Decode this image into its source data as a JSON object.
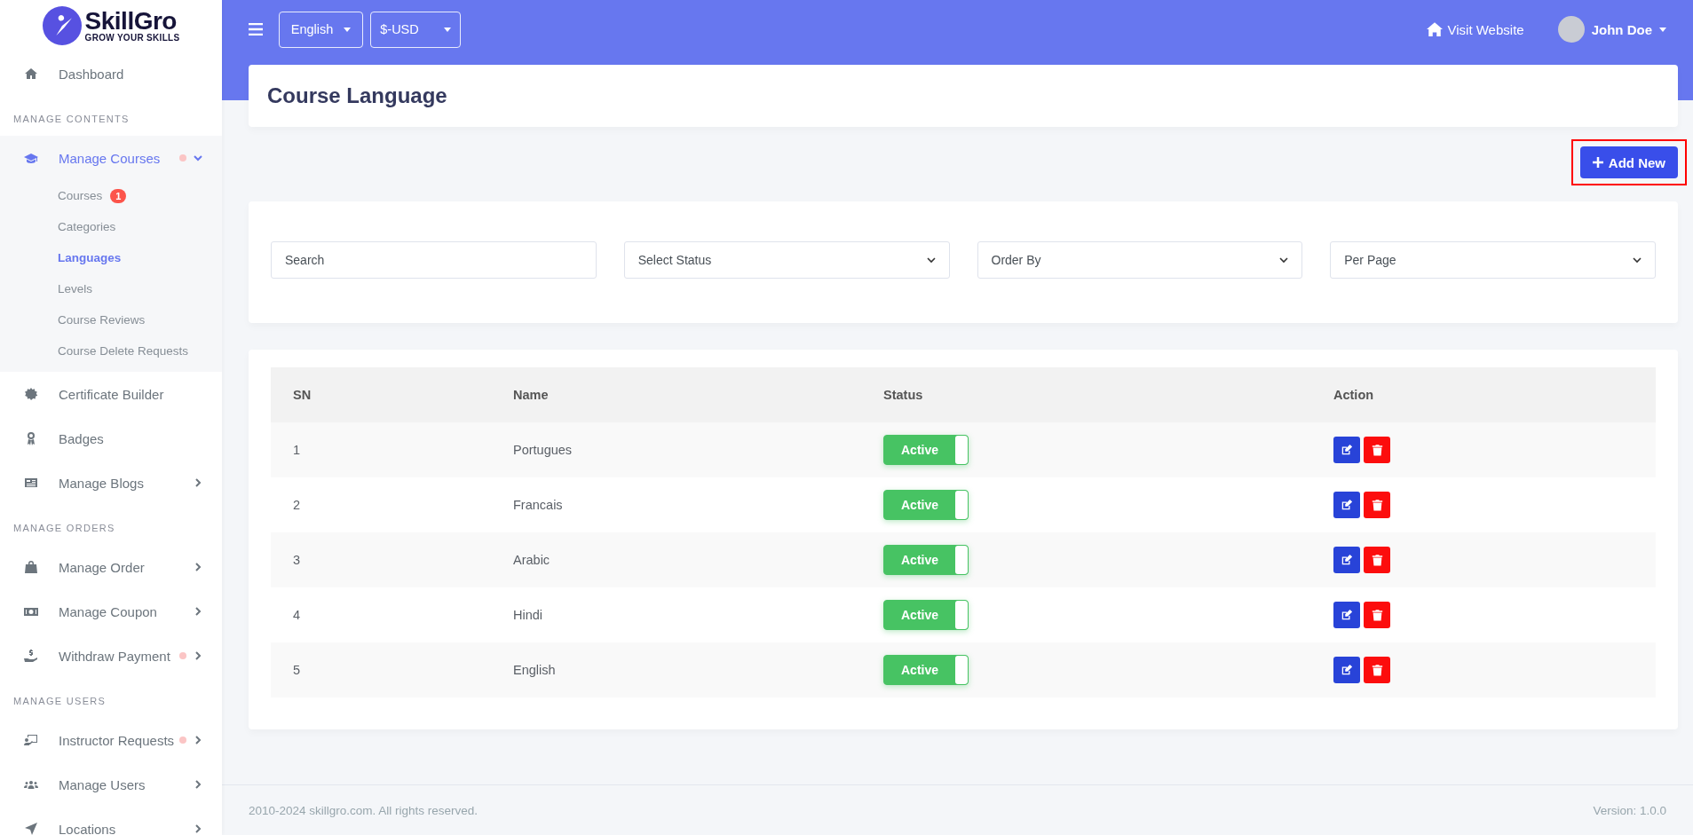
{
  "logo": {
    "name": "SkillGro",
    "tagline": "GROW YOUR SKILLS"
  },
  "sidebar": {
    "items": [
      {
        "kind": "link",
        "label": "Dashboard",
        "expandable": false,
        "expanded": false,
        "dot": false
      },
      {
        "kind": "section",
        "label": "MANAGE CONTENTS"
      },
      {
        "kind": "link",
        "label": "Manage Courses",
        "expandable": true,
        "expanded": true,
        "dot": true,
        "children": [
          {
            "label": "Courses",
            "badge": "1",
            "selected": false
          },
          {
            "label": "Categories",
            "selected": false
          },
          {
            "label": "Languages",
            "selected": true
          },
          {
            "label": "Levels",
            "selected": false
          },
          {
            "label": "Course Reviews",
            "selected": false
          },
          {
            "label": "Course Delete Requests",
            "selected": false
          }
        ]
      },
      {
        "kind": "link",
        "label": "Certificate Builder",
        "expandable": false,
        "expanded": false,
        "dot": false
      },
      {
        "kind": "link",
        "label": "Badges",
        "expandable": false,
        "expanded": false,
        "dot": false
      },
      {
        "kind": "link",
        "label": "Manage Blogs",
        "expandable": true,
        "expanded": false,
        "dot": false
      },
      {
        "kind": "section",
        "label": "MANAGE ORDERS"
      },
      {
        "kind": "link",
        "label": "Manage Order",
        "expandable": true,
        "expanded": false,
        "dot": false
      },
      {
        "kind": "link",
        "label": "Manage Coupon",
        "expandable": true,
        "expanded": false,
        "dot": false
      },
      {
        "kind": "link",
        "label": "Withdraw Payment",
        "expandable": true,
        "expanded": false,
        "dot": true
      },
      {
        "kind": "section",
        "label": "MANAGE USERS"
      },
      {
        "kind": "link",
        "label": "Instructor Requests",
        "expandable": true,
        "expanded": false,
        "dot": true
      },
      {
        "kind": "link",
        "label": "Manage Users",
        "expandable": true,
        "expanded": false,
        "dot": false
      },
      {
        "kind": "link",
        "label": "Locations",
        "expandable": true,
        "expanded": false,
        "dot": false
      }
    ]
  },
  "topbar": {
    "language": "English",
    "currency": "$-USD",
    "visit_website": "Visit Website",
    "user": "John Doe"
  },
  "page": {
    "title": "Course Language",
    "add_button": "Add New",
    "add_button_highlighted": true
  },
  "filters": {
    "search": {
      "placeholder": "Search"
    },
    "selects": [
      "Select Status",
      "Order By",
      "Per Page"
    ]
  },
  "table": {
    "columns": [
      "SN",
      "Name",
      "Status",
      "Action"
    ],
    "rows": [
      {
        "sn": "1",
        "name": "Portugues",
        "status": "Active",
        "on": true
      },
      {
        "sn": "2",
        "name": "Francais",
        "status": "Active",
        "on": true
      },
      {
        "sn": "3",
        "name": "Arabic",
        "status": "Active",
        "on": true
      },
      {
        "sn": "4",
        "name": "Hindi",
        "status": "Active",
        "on": true
      },
      {
        "sn": "5",
        "name": "English",
        "status": "Active",
        "on": true
      }
    ]
  },
  "footer": {
    "copyright": "2010-2024 skillgro.com. All rights reserved.",
    "version": "Version: 1.0.0"
  }
}
